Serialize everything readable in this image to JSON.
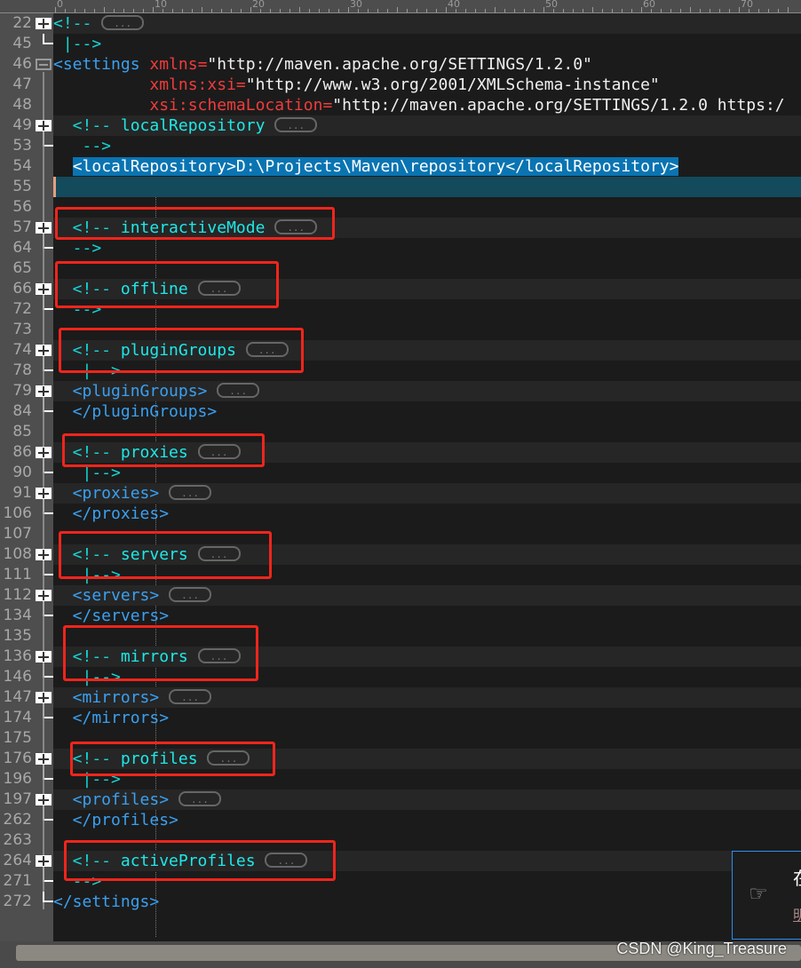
{
  "ruler": {
    "labels": [
      "0",
      "10",
      "20",
      "30",
      "40",
      "50",
      "60",
      "70"
    ]
  },
  "rows": [
    {
      "num": "22",
      "fold": "plus",
      "tokens": [
        [
          "c",
          "<!-- "
        ],
        [
          "pill",
          ""
        ]
      ]
    },
    {
      "num": "45",
      "fold": "end",
      "tokens": [
        [
          "c",
          " |-->"
        ]
      ]
    },
    {
      "num": "46",
      "fold": "minus",
      "tokens": [
        [
          "t",
          "<settings "
        ],
        [
          "a",
          "xmlns"
        ],
        [
          "e",
          "="
        ],
        [
          "v",
          "\"http://maven.apache.org/SETTINGS/1.2.0\""
        ]
      ]
    },
    {
      "num": "47",
      "fold": "",
      "tokens": [
        [
          "v",
          "          "
        ],
        [
          "a",
          "xmlns:xsi"
        ],
        [
          "e",
          "="
        ],
        [
          "v",
          "\"http://www.w3.org/2001/XMLSchema-instance\""
        ]
      ]
    },
    {
      "num": "48",
      "fold": "",
      "tokens": [
        [
          "v",
          "          "
        ],
        [
          "a",
          "xsi:schemaLocation"
        ],
        [
          "e",
          "="
        ],
        [
          "v",
          "\"http://maven.apache.org/SETTINGS/1.2.0 https:/"
        ]
      ]
    },
    {
      "num": "49",
      "fold": "plus",
      "tokens": [
        [
          "c",
          "  <!-- "
        ],
        [
          "ct",
          "localRepository "
        ],
        [
          "pill",
          ""
        ]
      ]
    },
    {
      "num": "53",
      "fold": "end",
      "tokens": [
        [
          "c",
          "   -->"
        ]
      ]
    },
    {
      "num": "54",
      "fold": "",
      "tokens": [
        [
          "v",
          "  "
        ],
        [
          "sel",
          "<localRepository>D:\\Projects\\Maven\\repository</localRepository>"
        ]
      ]
    },
    {
      "num": "55",
      "fold": "",
      "caret": true,
      "tokens": []
    },
    {
      "num": "56",
      "fold": "",
      "tokens": []
    },
    {
      "num": "57",
      "fold": "plus",
      "tokens": [
        [
          "c",
          "  <!-- "
        ],
        [
          "ct",
          "interactiveMode "
        ],
        [
          "pill",
          ""
        ]
      ]
    },
    {
      "num": "64",
      "fold": "end",
      "tokens": [
        [
          "c",
          "  -->"
        ]
      ]
    },
    {
      "num": "65",
      "fold": "",
      "tokens": []
    },
    {
      "num": "66",
      "fold": "plus",
      "tokens": [
        [
          "c",
          "  <!-- "
        ],
        [
          "ct",
          "offline "
        ],
        [
          "pill",
          ""
        ]
      ]
    },
    {
      "num": "72",
      "fold": "end",
      "tokens": [
        [
          "c",
          "  -->"
        ]
      ]
    },
    {
      "num": "73",
      "fold": "",
      "tokens": []
    },
    {
      "num": "74",
      "fold": "plus",
      "tokens": [
        [
          "c",
          "  <!-- "
        ],
        [
          "ct",
          "pluginGroups "
        ],
        [
          "pill",
          ""
        ]
      ]
    },
    {
      "num": "78",
      "fold": "end",
      "tokens": [
        [
          "c",
          "   |-->"
        ]
      ]
    },
    {
      "num": "79",
      "fold": "plus",
      "tokens": [
        [
          "t",
          "  <pluginGroups> "
        ],
        [
          "pill",
          ""
        ]
      ]
    },
    {
      "num": "84",
      "fold": "end",
      "tokens": [
        [
          "t",
          "  </pluginGroups>"
        ]
      ]
    },
    {
      "num": "85",
      "fold": "",
      "tokens": []
    },
    {
      "num": "86",
      "fold": "plus",
      "tokens": [
        [
          "c",
          "  <!-- "
        ],
        [
          "ct",
          "proxies "
        ],
        [
          "pill",
          ""
        ]
      ]
    },
    {
      "num": "90",
      "fold": "end",
      "tokens": [
        [
          "c",
          "   |-->"
        ]
      ]
    },
    {
      "num": "91",
      "fold": "plus",
      "tokens": [
        [
          "t",
          "  <proxies> "
        ],
        [
          "pill",
          ""
        ]
      ]
    },
    {
      "num": "106",
      "fold": "end",
      "tokens": [
        [
          "t",
          "  </proxies>"
        ]
      ]
    },
    {
      "num": "107",
      "fold": "",
      "tokens": []
    },
    {
      "num": "108",
      "fold": "plus",
      "tokens": [
        [
          "c",
          "  <!-- "
        ],
        [
          "ct",
          "servers "
        ],
        [
          "pill",
          ""
        ]
      ]
    },
    {
      "num": "111",
      "fold": "end",
      "tokens": [
        [
          "c",
          "   |-->"
        ]
      ]
    },
    {
      "num": "112",
      "fold": "plus",
      "tokens": [
        [
          "t",
          "  <servers> "
        ],
        [
          "pill",
          ""
        ]
      ]
    },
    {
      "num": "134",
      "fold": "end",
      "tokens": [
        [
          "t",
          "  </servers>"
        ]
      ]
    },
    {
      "num": "135",
      "fold": "",
      "tokens": []
    },
    {
      "num": "136",
      "fold": "plus",
      "tokens": [
        [
          "c",
          "  <!-- "
        ],
        [
          "ct",
          "mirrors "
        ],
        [
          "pill",
          ""
        ]
      ]
    },
    {
      "num": "146",
      "fold": "end",
      "tokens": [
        [
          "c",
          "   |-->"
        ]
      ]
    },
    {
      "num": "147",
      "fold": "plus",
      "tokens": [
        [
          "t",
          "  <mirrors> "
        ],
        [
          "pill",
          ""
        ]
      ]
    },
    {
      "num": "174",
      "fold": "end",
      "tokens": [
        [
          "t",
          "  </mirrors>"
        ]
      ]
    },
    {
      "num": "175",
      "fold": "",
      "tokens": []
    },
    {
      "num": "176",
      "fold": "plus",
      "tokens": [
        [
          "c",
          "  <!-- "
        ],
        [
          "ct",
          "profiles "
        ],
        [
          "pill",
          ""
        ]
      ]
    },
    {
      "num": "196",
      "fold": "end",
      "tokens": [
        [
          "c",
          "   |-->"
        ]
      ]
    },
    {
      "num": "197",
      "fold": "plus",
      "tokens": [
        [
          "t",
          "  <profiles> "
        ],
        [
          "pill",
          ""
        ]
      ]
    },
    {
      "num": "262",
      "fold": "end",
      "tokens": [
        [
          "t",
          "  </profiles>"
        ]
      ]
    },
    {
      "num": "263",
      "fold": "",
      "tokens": []
    },
    {
      "num": "264",
      "fold": "plus",
      "tokens": [
        [
          "c",
          "  <!-- "
        ],
        [
          "ct",
          "activeProfiles "
        ],
        [
          "pill",
          ""
        ]
      ]
    },
    {
      "num": "271",
      "fold": "end",
      "tokens": [
        [
          "c",
          "  -->"
        ]
      ]
    },
    {
      "num": "272",
      "fold": "end",
      "tokens": [
        [
          "t",
          "</settings>"
        ]
      ]
    }
  ],
  "fold_pill_label": "...",
  "popup": {
    "icon": "pointing-hand-icon",
    "line1": "在",
    "line2": "明"
  },
  "watermark": "CSDN @King_Treasure",
  "colors": {
    "highlight_box": "#f0251c",
    "selection": "#0a74b2",
    "comment": "#1ee8e8",
    "tag": "#3aa0f0",
    "attribute": "#f03c3c"
  }
}
